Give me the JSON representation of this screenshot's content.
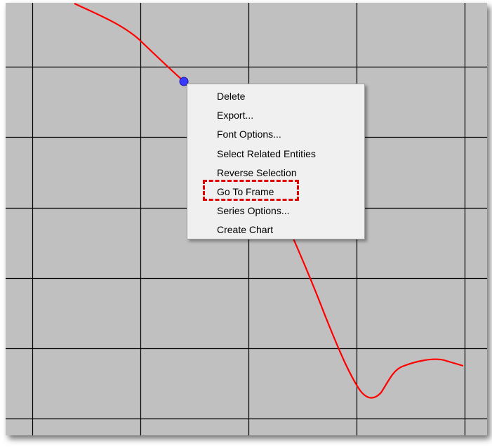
{
  "colors": {
    "plot_background": "#c0c0c0",
    "grid_line": "#000000",
    "series_line": "#ff0000",
    "selected_point": "#3a3aff",
    "menu_background": "#f0f0f0",
    "highlight": "#e00000"
  },
  "context_menu": {
    "items": [
      {
        "label": "Delete"
      },
      {
        "label": "Export..."
      },
      {
        "label": "Font Options..."
      },
      {
        "label": "Select Related Entities"
      },
      {
        "label": "Reverse Selection"
      },
      {
        "label": "Go To Frame"
      },
      {
        "label": "Series Options..."
      },
      {
        "label": "Create Chart"
      }
    ],
    "highlighted_item": "Go To Frame"
  }
}
